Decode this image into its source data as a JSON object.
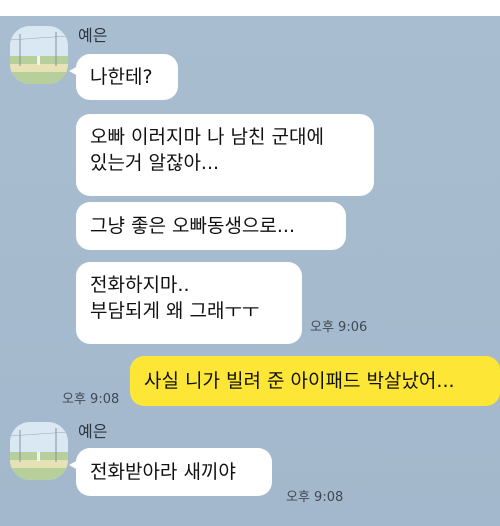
{
  "chat": {
    "sender_name": "예은",
    "messages": [
      {
        "text": "나한테?"
      },
      {
        "text": "오빠 이러지마 나 남친 군대에\n있는거 알잖아..."
      },
      {
        "text": "그냥 좋은 오빠동생으로..."
      },
      {
        "text": "전화하지마..\n부담되게 왜 그래ㅜㅜ",
        "time": "오후 9:06"
      },
      {
        "text": "사실 니가 빌려 준 아이패드 박살났어...",
        "time": "오후 9:08"
      },
      {
        "text": "전화받아라 새끼야",
        "time": "오후 9:08"
      }
    ]
  },
  "colors": {
    "chat_background": "#a9bdd0",
    "incoming_bubble": "#ffffff",
    "outgoing_bubble": "#fde636"
  },
  "icons": {
    "avatar": "profile-photo-landscape"
  }
}
